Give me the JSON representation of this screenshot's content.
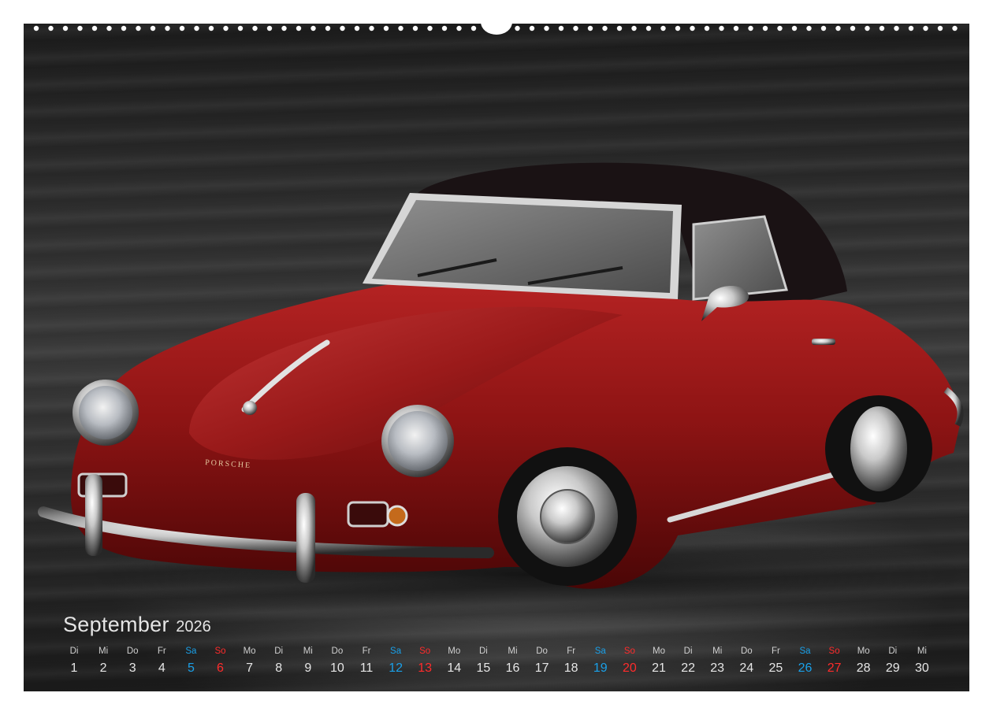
{
  "calendar": {
    "month": "September",
    "year": "2026",
    "days": [
      {
        "weekday": "Di",
        "day": "1",
        "type": "weekday"
      },
      {
        "weekday": "Mi",
        "day": "2",
        "type": "weekday"
      },
      {
        "weekday": "Do",
        "day": "3",
        "type": "weekday"
      },
      {
        "weekday": "Fr",
        "day": "4",
        "type": "weekday"
      },
      {
        "weekday": "Sa",
        "day": "5",
        "type": "saturday"
      },
      {
        "weekday": "So",
        "day": "6",
        "type": "sunday"
      },
      {
        "weekday": "Mo",
        "day": "7",
        "type": "weekday"
      },
      {
        "weekday": "Di",
        "day": "8",
        "type": "weekday"
      },
      {
        "weekday": "Mi",
        "day": "9",
        "type": "weekday"
      },
      {
        "weekday": "Do",
        "day": "10",
        "type": "weekday"
      },
      {
        "weekday": "Fr",
        "day": "11",
        "type": "weekday"
      },
      {
        "weekday": "Sa",
        "day": "12",
        "type": "saturday"
      },
      {
        "weekday": "So",
        "day": "13",
        "type": "sunday"
      },
      {
        "weekday": "Mo",
        "day": "14",
        "type": "weekday"
      },
      {
        "weekday": "Di",
        "day": "15",
        "type": "weekday"
      },
      {
        "weekday": "Mi",
        "day": "16",
        "type": "weekday"
      },
      {
        "weekday": "Do",
        "day": "17",
        "type": "weekday"
      },
      {
        "weekday": "Fr",
        "day": "18",
        "type": "weekday"
      },
      {
        "weekday": "Sa",
        "day": "19",
        "type": "saturday"
      },
      {
        "weekday": "So",
        "day": "20",
        "type": "sunday"
      },
      {
        "weekday": "Mo",
        "day": "21",
        "type": "weekday"
      },
      {
        "weekday": "Di",
        "day": "22",
        "type": "weekday"
      },
      {
        "weekday": "Mi",
        "day": "23",
        "type": "weekday"
      },
      {
        "weekday": "Do",
        "day": "24",
        "type": "weekday"
      },
      {
        "weekday": "Fr",
        "day": "25",
        "type": "weekday"
      },
      {
        "weekday": "Sa",
        "day": "26",
        "type": "saturday"
      },
      {
        "weekday": "So",
        "day": "27",
        "type": "sunday"
      },
      {
        "weekday": "Mo",
        "day": "28",
        "type": "weekday"
      },
      {
        "weekday": "Di",
        "day": "29",
        "type": "weekday"
      },
      {
        "weekday": "Mi",
        "day": "30",
        "type": "weekday"
      }
    ]
  },
  "photo": {
    "subject": "red-classic-convertible",
    "badge_text": "PORSCHE"
  },
  "colors": {
    "saturday": "#1aa0e8",
    "sunday": "#ff2b2b",
    "car_red": "#8e1414",
    "background": "#2a2a2a"
  }
}
